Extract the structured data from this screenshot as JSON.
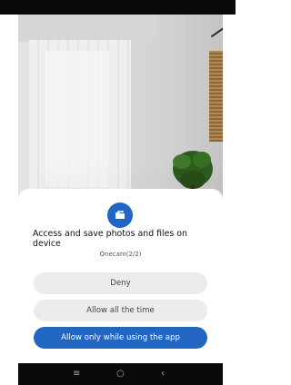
{
  "dialog": {
    "title": "Access and save photos and files on device",
    "subtitle": "Onecam(2/2)",
    "buttons": {
      "deny": "Deny",
      "allow_all_time": "Allow all the time",
      "allow_while_using": "Allow only while using the app"
    },
    "accent_color": "#2266c4"
  },
  "nav_bar": {
    "menu_icon": "≡",
    "home_icon": "○",
    "back_icon": "‹"
  }
}
